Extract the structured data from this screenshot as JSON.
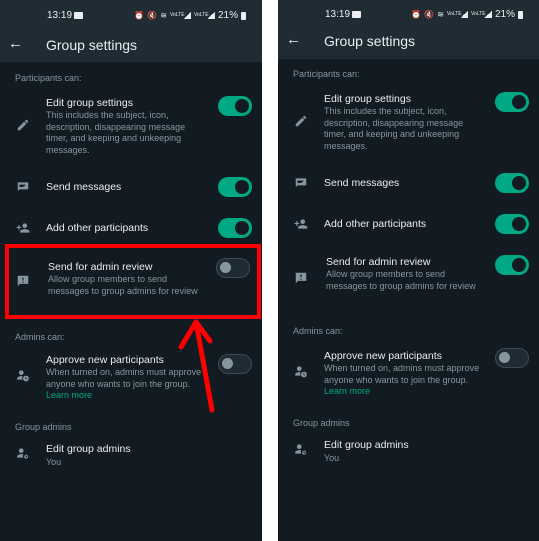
{
  "screens": [
    {
      "status_bar": {
        "time": "13:19",
        "battery": "21%",
        "volte1": "VoLTE",
        "volte2": "VoLTE"
      },
      "header": {
        "back_icon": "arrow-left-icon",
        "title": "Group settings"
      },
      "sections": {
        "participants": "Participants can:",
        "admins": "Admins can:",
        "group_admins": "Group admins"
      },
      "items": {
        "edit_settings": {
          "label": "Edit group settings",
          "desc": "This includes the subject, icon, description, disappearing message timer, and keeping and unkeeping messages.",
          "icon": "pencil-icon",
          "enabled": true
        },
        "send_messages": {
          "label": "Send messages",
          "icon": "message-icon",
          "enabled": true
        },
        "add_participants": {
          "label": "Add other participants",
          "icon": "add-person-icon",
          "enabled": true
        },
        "admin_review": {
          "label": "Send for admin review",
          "desc": "Allow group members to send messages to group admins for review",
          "icon": "report-message-icon",
          "enabled": false
        },
        "approve": {
          "label": "Approve new participants",
          "desc": "When turned on, admins must approve anyone who wants to join the group.",
          "link": "Learn more",
          "icon": "person-clock-icon",
          "enabled": false
        },
        "edit_admins": {
          "label": "Edit group admins",
          "desc": "You",
          "icon": "person-gear-icon"
        }
      }
    },
    {
      "status_bar": {
        "time": "13:19",
        "battery": "21%",
        "volte1": "VoLTE",
        "volte2": "VoLTE"
      },
      "header": {
        "back_icon": "arrow-left-icon",
        "title": "Group settings"
      },
      "sections": {
        "participants": "Participants can:",
        "admins": "Admins can:",
        "group_admins": "Group admins"
      },
      "items": {
        "edit_settings": {
          "label": "Edit group settings",
          "desc": "This includes the subject, icon, description, disappearing message timer, and keeping and unkeeping messages.",
          "icon": "pencil-icon",
          "enabled": true
        },
        "send_messages": {
          "label": "Send messages",
          "icon": "message-icon",
          "enabled": true
        },
        "add_participants": {
          "label": "Add other participants",
          "icon": "add-person-icon",
          "enabled": true
        },
        "admin_review": {
          "label": "Send for admin review",
          "desc": "Allow group members to send messages to group admins for review",
          "icon": "report-message-icon",
          "enabled": true
        },
        "approve": {
          "label": "Approve new participants",
          "desc": "When turned on, admins must approve anyone who wants to join the group.",
          "link": "Learn more",
          "icon": "person-clock-icon",
          "enabled": false
        },
        "edit_admins": {
          "label": "Edit group admins",
          "desc": "You",
          "icon": "person-gear-icon"
        }
      }
    }
  ],
  "annotation": {
    "highlight_color": "#ff0000",
    "target": "Send for admin review"
  },
  "colors": {
    "accent": "#00a884",
    "background": "#111b21",
    "header": "#1f2c34",
    "text": "#e9edef",
    "secondary": "#8696a0"
  }
}
